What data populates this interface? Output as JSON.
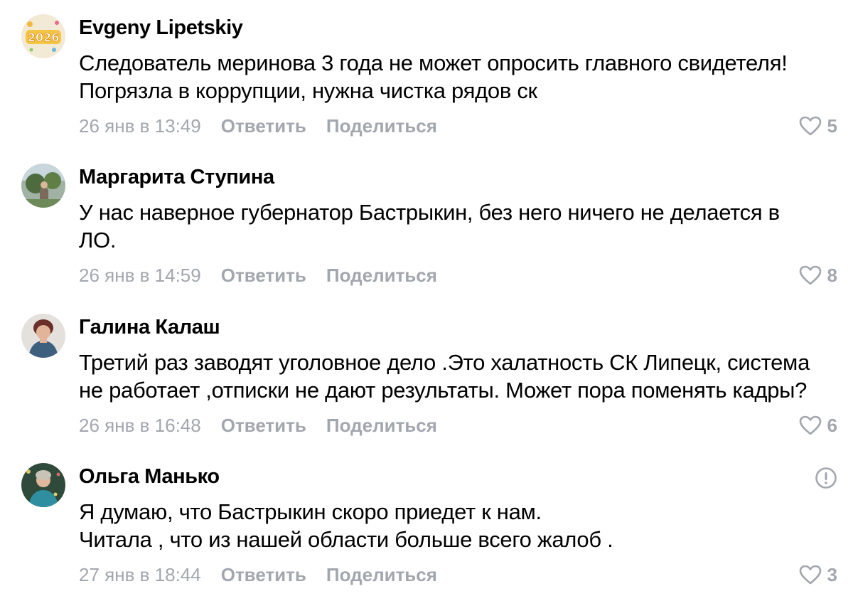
{
  "comments": [
    {
      "author": "Evgeny Lipetskiy",
      "avatar_icon": "avatar-2026-badge",
      "text_lines": [
        "Следователь меринова 3 года не может опросить главного свидетеля!",
        "Погрязла в коррупции, нужна чистка рядов ск"
      ],
      "date": "26 янв в 13:49",
      "reply_label": "Ответить",
      "share_label": "Поделиться",
      "likes": "5",
      "avatar_text": "2026"
    },
    {
      "author": "Маргарита Ступина",
      "avatar_icon": "avatar-photo",
      "text_lines": [
        "У нас наверное губернатор Бастрыкин, без него ничего не делается в",
        "ЛО."
      ],
      "date": "26 янв в 14:59",
      "reply_label": "Ответить",
      "share_label": "Поделиться",
      "likes": "8"
    },
    {
      "author": "Галина Калаш",
      "avatar_icon": "avatar-photo",
      "text_lines": [
        "Третий раз заводят уголовное дело .Это халатность СК Липецк, система",
        "не работает ,отписки не дают результаты. Может пора поменять кадры?"
      ],
      "date": "26 янв в 16:48",
      "reply_label": "Ответить",
      "share_label": "Поделиться",
      "likes": "6"
    },
    {
      "author": "Ольга Манько",
      "avatar_icon": "avatar-photo",
      "report_icon": "report-exclamation-icon",
      "text_lines": [
        "Я думаю, что Бастрыкин скоро приедет к нам.",
        "Читала , что из нашей области больше всего жалоб ."
      ],
      "date": "27 янв в 18:44",
      "reply_label": "Ответить",
      "share_label": "Поделиться",
      "likes": "3"
    }
  ],
  "colors": {
    "text": "#000000",
    "muted": "#a2a7ae",
    "background": "#ffffff"
  }
}
